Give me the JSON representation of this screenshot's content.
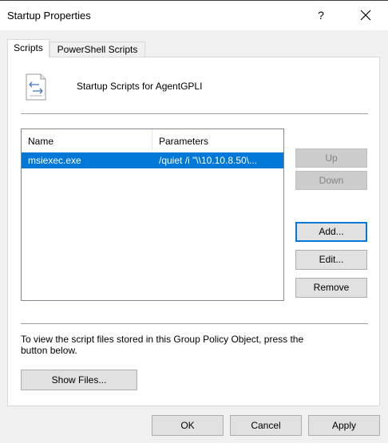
{
  "window": {
    "title": "Startup Properties",
    "help_label": "?",
    "close_label": "✕"
  },
  "tabs": [
    {
      "label": "Scripts",
      "selected": true
    },
    {
      "label": "PowerShell Scripts",
      "selected": false
    }
  ],
  "panel": {
    "header_icon": "script-document-icon",
    "header_text": "Startup Scripts for AgentGPLI"
  },
  "scripts_list": {
    "columns": [
      "Name",
      "Parameters"
    ],
    "rows": [
      {
        "name": "msiexec.exe",
        "parameters": "/quiet /i \"\\\\10.10.8.50\\...",
        "selected": true
      }
    ]
  },
  "side_buttons": {
    "up": "Up",
    "down": "Down",
    "add": "Add...",
    "edit": "Edit...",
    "remove": "Remove"
  },
  "info": {
    "text": "To view the script files stored in this Group Policy Object, press the button below.",
    "show_files": "Show Files..."
  },
  "footer": {
    "ok": "OK",
    "cancel": "Cancel",
    "apply": "Apply"
  },
  "colors": {
    "selection": "#0078d7",
    "dialog_bg": "#f0f0f0",
    "panel_bg": "#ffffff",
    "button_bg": "#e1e1e1",
    "disabled_text": "#838383"
  }
}
